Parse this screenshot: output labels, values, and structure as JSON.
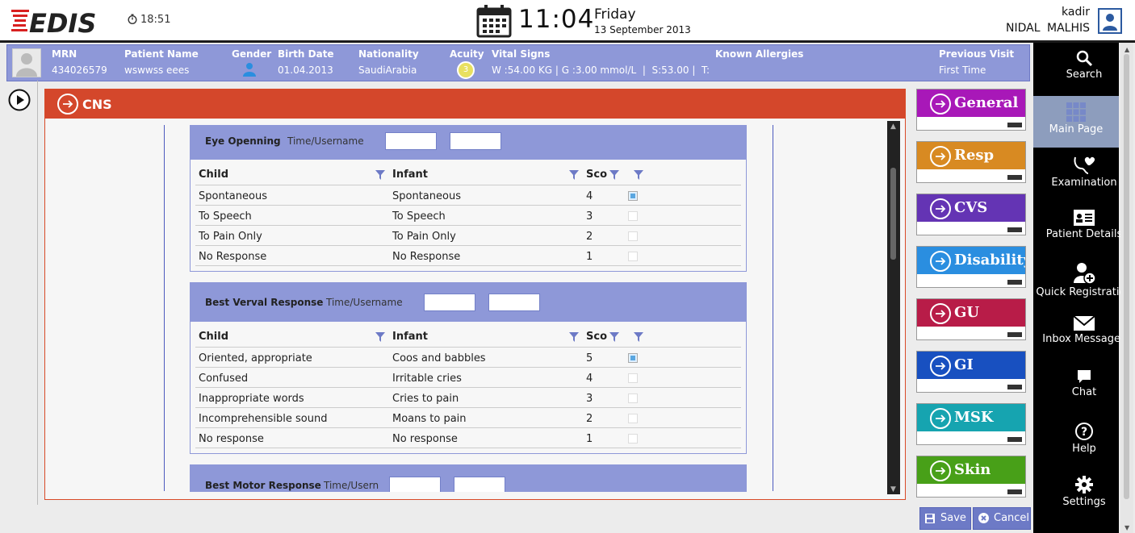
{
  "app": {
    "logo": "EDIS",
    "small_time": "18:51",
    "time": "11:04",
    "day": "Friday",
    "date": "13 September 2013"
  },
  "user": {
    "login": "kadir",
    "name": "NIDAL  MALHIS"
  },
  "patient": {
    "labels": {
      "mrn": "MRN",
      "name": "Patient Name",
      "gender": "Gender",
      "birth": "Birth Date",
      "nationality": "Nationality",
      "acuity": "Acuity",
      "vitals": "Vital Signs",
      "allergies": "Known Allergies",
      "prev": "Previous Visit"
    },
    "mrn": "434026579",
    "name": "wswwss eees",
    "birth": "01.04.2013",
    "nationality": "SaudiArabia",
    "acuity": "3",
    "vitals": "W :54.00 KG | G :3.00 mmol/L  |  S:53.00 |  T:",
    "prev": "First Time"
  },
  "sidebar": {
    "items": [
      {
        "label": "Search",
        "icon": "search-icon"
      },
      {
        "label": "Main Page",
        "icon": "grid-icon"
      },
      {
        "label": "Examination",
        "icon": "stethoscope-heart-icon"
      },
      {
        "label": "Patient Details",
        "icon": "id-card-icon"
      },
      {
        "label": "Quick Registration",
        "icon": "add-user-icon"
      },
      {
        "label": "Inbox Messages",
        "icon": "envelope-icon"
      },
      {
        "label": "Chat",
        "icon": "chat-icon"
      },
      {
        "label": "Help",
        "icon": "help-icon"
      },
      {
        "label": "Settings",
        "icon": "gear-icon"
      }
    ]
  },
  "panel": {
    "title": "CNS",
    "color": "#d4472b"
  },
  "cards": {
    "eye": {
      "title": "Eye Openning",
      "tu": "Time/Username",
      "headers": {
        "child": "Child",
        "infant": "Infant",
        "score": "Sco"
      },
      "rows": [
        {
          "child": "Spontaneous",
          "infant": "Spontaneous",
          "score": "4",
          "checked": true
        },
        {
          "child": "To Speech",
          "infant": "To Speech",
          "score": "3",
          "checked": false
        },
        {
          "child": "To Pain Only",
          "infant": "To Pain Only",
          "score": "2",
          "checked": false
        },
        {
          "child": "No Response",
          "infant": "No Response",
          "score": "1",
          "checked": false
        }
      ]
    },
    "verbal": {
      "title": "Best Verval Response",
      "tu": "Time/Username",
      "headers": {
        "child": "Child",
        "infant": "Infant",
        "score": "Sco"
      },
      "rows": [
        {
          "child": "Oriented, appropriate",
          "infant": "Coos and babbles",
          "score": "5",
          "checked": true
        },
        {
          "child": "Confused",
          "infant": "Irritable cries",
          "score": "4",
          "checked": false
        },
        {
          "child": "Inappropriate words",
          "infant": "Cries to pain",
          "score": "3",
          "checked": false
        },
        {
          "child": "Incomprehensible sound",
          "infant": "Moans to pain",
          "score": "2",
          "checked": false
        },
        {
          "child": "No response",
          "infant": "No response",
          "score": "1",
          "checked": false
        }
      ]
    },
    "motor": {
      "title": "Best Motor Response",
      "tu": "Time/Usern"
    }
  },
  "sections": [
    {
      "label": "General",
      "color": "#a818b8"
    },
    {
      "label": "Resp",
      "color": "#d88a22"
    },
    {
      "label": "CVS",
      "color": "#6434b4"
    },
    {
      "label": "Disability",
      "color": "#2a8ee0"
    },
    {
      "label": "GU",
      "color": "#b81c48"
    },
    {
      "label": "GI",
      "color": "#1850c0"
    },
    {
      "label": "MSK",
      "color": "#16a4b0"
    },
    {
      "label": "Skin",
      "color": "#48a018"
    }
  ],
  "buttons": {
    "save": "Save",
    "cancel": "Cancel"
  }
}
